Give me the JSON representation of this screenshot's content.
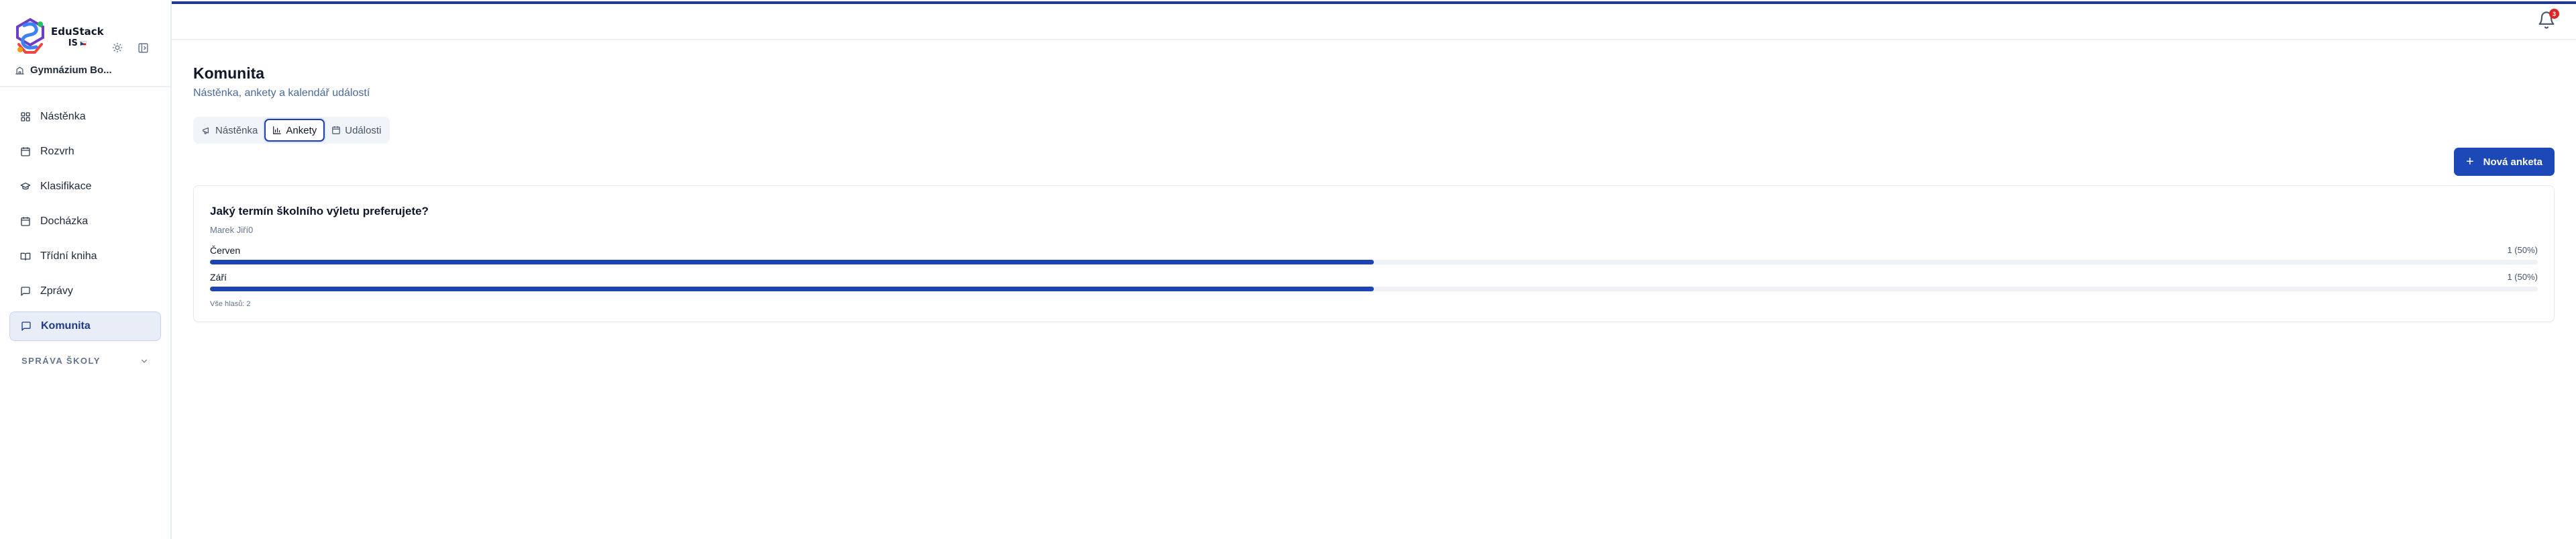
{
  "brand": {
    "name": "EduStack",
    "sub": "IS"
  },
  "school": {
    "name": "Gymnázium Bo..."
  },
  "sidebar": {
    "items": [
      {
        "label": "Nástěnka",
        "icon": "dashboard-icon"
      },
      {
        "label": "Rozvrh",
        "icon": "calendar-icon"
      },
      {
        "label": "Klasifikace",
        "icon": "graduation-cap-icon"
      },
      {
        "label": "Docházka",
        "icon": "calendar-check-icon"
      },
      {
        "label": "Třídní kniha",
        "icon": "book-open-icon"
      },
      {
        "label": "Zprávy",
        "icon": "message-icon"
      },
      {
        "label": "Komunita",
        "icon": "message-square-icon",
        "active": true
      }
    ],
    "section_label": "SPRÁVA ŠKOLY"
  },
  "notifications": {
    "count": "3"
  },
  "page": {
    "title": "Komunita",
    "subtitle": "Nástěnka, ankety a kalendář událostí"
  },
  "tabs": [
    {
      "label": "Nástěnka",
      "icon": "megaphone-icon"
    },
    {
      "label": "Ankety",
      "icon": "bar-chart-icon",
      "active": true
    },
    {
      "label": "Události",
      "icon": "calendar-icon"
    }
  ],
  "actions": {
    "new_poll_label": "Nová anketa"
  },
  "poll": {
    "question": "Jaký termín školního výletu preferujete?",
    "author": "Marek Jiří0",
    "options": [
      {
        "label": "Červen",
        "result": "1 (50%)",
        "percent": 50
      },
      {
        "label": "Září",
        "result": "1 (50%)",
        "percent": 50
      }
    ],
    "total": "Vše hlasů: 2"
  },
  "colors": {
    "accent": "#1d48b8",
    "topline": "#1e3a8a",
    "badge": "#dc2626"
  }
}
